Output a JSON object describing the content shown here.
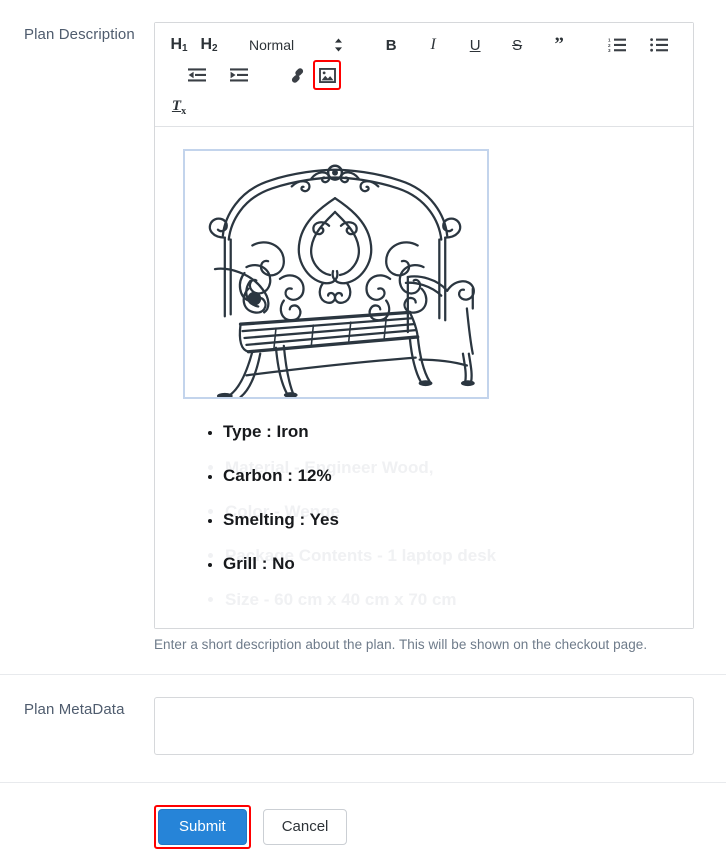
{
  "form": {
    "description_label": "Plan Description",
    "metadata_label": "Plan MetaData",
    "help_text": "Enter a short description about the plan. This will be shown on the checkout page.",
    "metadata_value": "",
    "metadata_placeholder": ""
  },
  "toolbar": {
    "h1_label": "H",
    "h1_sub": "1",
    "h2_label": "H",
    "h2_sub": "2",
    "format_select_value": "Normal",
    "bold_label": "B",
    "italic_label": "I",
    "underline_label": "U",
    "strike_label": "S",
    "quote_label": "”",
    "clear_label": "T",
    "clear_sub": "x",
    "items": [
      {
        "name": "header-1",
        "label": "H1"
      },
      {
        "name": "header-2",
        "label": "H2"
      },
      {
        "name": "format-select",
        "label": "Normal"
      },
      {
        "name": "bold",
        "label": "B"
      },
      {
        "name": "italic",
        "label": "I"
      },
      {
        "name": "underline",
        "label": "U"
      },
      {
        "name": "strikethrough",
        "label": "S"
      },
      {
        "name": "blockquote",
        "label": "”"
      },
      {
        "name": "ordered-list",
        "label": "Ordered List"
      },
      {
        "name": "bullet-list",
        "label": "Bullet List"
      },
      {
        "name": "outdent",
        "label": "Outdent"
      },
      {
        "name": "indent",
        "label": "Indent"
      },
      {
        "name": "link",
        "label": "Link"
      },
      {
        "name": "image",
        "label": "Image"
      },
      {
        "name": "clear-formatting",
        "label": "Tx"
      }
    ],
    "highlight_color": "#ff0000",
    "active_item": "image"
  },
  "editor": {
    "image_alt": "wrought iron scrollwork garden bench",
    "image_selected": true,
    "selection_border_color": "#c3d4ec",
    "bullets": [
      "Type : Iron",
      "Carbon : 12%",
      "Smelting : Yes",
      "Grill : No"
    ],
    "ghost_bullets": [
      "Material - Engineer Wood,",
      "Color - Wenge",
      "Package Contents - 1 laptop desk",
      "Size - 60 cm x 40 cm x 70 cm"
    ]
  },
  "buttons": {
    "submit_label": "Submit",
    "cancel_label": "Cancel",
    "submit_color": "#2684d8",
    "submit_highlight": "#ff0000"
  }
}
